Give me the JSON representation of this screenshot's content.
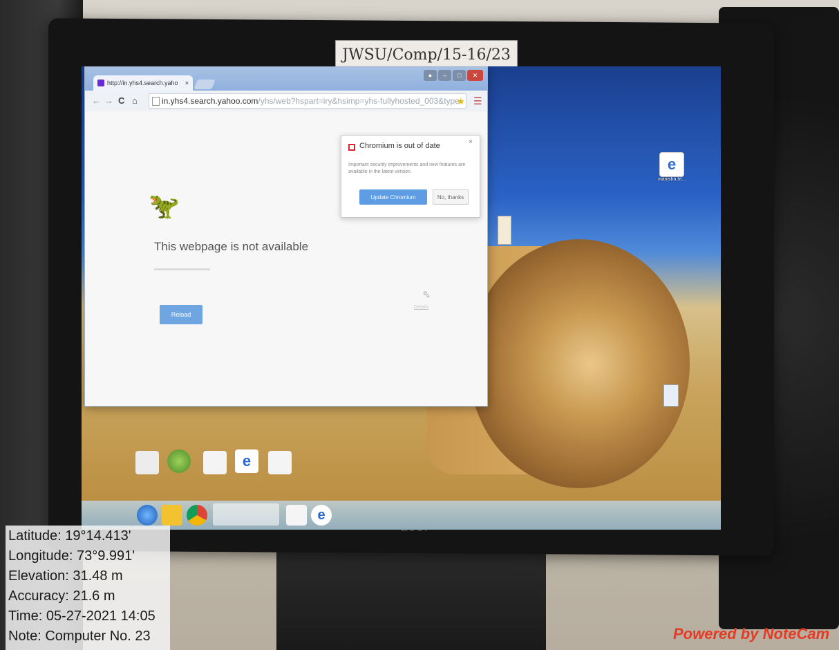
{
  "sticker": {
    "text": "JWSU/Comp/15-16/23"
  },
  "monitor": {
    "brand": "acer"
  },
  "browser": {
    "tab_title": "http://in.yhs4.search.yaho",
    "tab_close": "×",
    "url_host": "in.yhs4.search.yahoo.com",
    "url_path": "/yhs/web?hspart=iry&hsimp=yhs-fullyhosted_003&type",
    "error_title": "This webpage is not available",
    "reload_label": "Reload",
    "details_label": "Details"
  },
  "bubble": {
    "title": "Chromium is out of date",
    "body": "Important security improvements and new features are available in the latest version.",
    "update_label": "Update Chromium",
    "no_thanks_label": "No, thanks",
    "close": "×"
  },
  "desktop": {
    "icons": [
      {
        "name": "manisha-html",
        "label": "manisha.ht..."
      }
    ]
  },
  "notecam": {
    "latitude": "Latitude: 19°14.413'",
    "longitude": "Longitude: 73°9.991'",
    "elevation": "Elevation: 31.48 m",
    "accuracy": "Accuracy: 21.6 m",
    "time": "Time: 05-27-2021 14:05",
    "note": "Note: Computer No. 23",
    "powered_by": "Powered by NoteCam"
  },
  "colors": {
    "accent": "#5e9de3",
    "notecam_brand": "#e53a24"
  }
}
